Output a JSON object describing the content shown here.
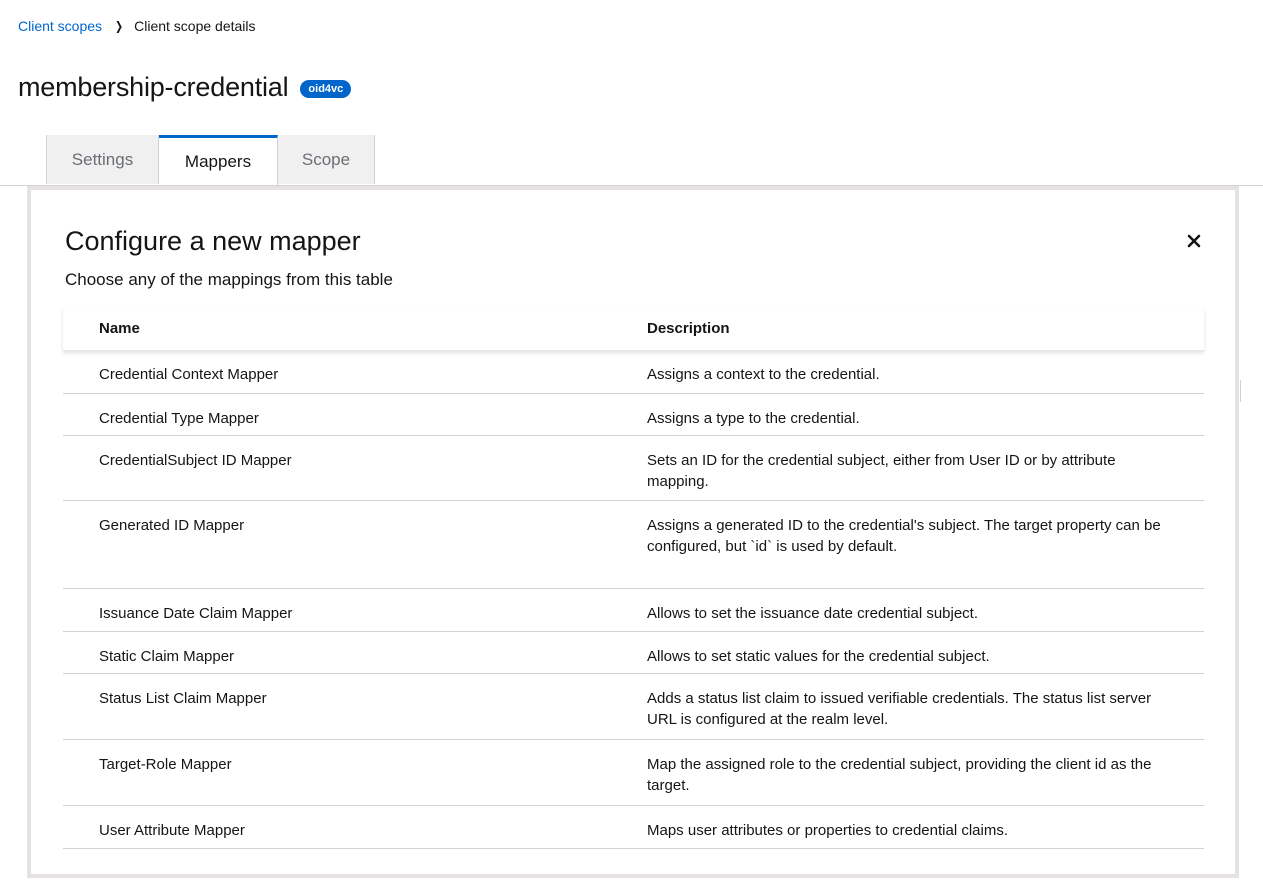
{
  "breadcrumb": {
    "parent": "Client scopes",
    "current": "Client scope details"
  },
  "header": {
    "title": "membership-credential",
    "badge": "oid4vc"
  },
  "tabs": [
    {
      "label": "Settings"
    },
    {
      "label": "Mappers"
    },
    {
      "label": "Scope"
    }
  ],
  "modal": {
    "title": "Configure a new mapper",
    "description": "Choose any of the mappings from this table",
    "close_icon": "close-icon",
    "columns": {
      "name": "Name",
      "description": "Description"
    },
    "rows": [
      {
        "name": "Credential Context Mapper",
        "description": "Assigns a context to the credential."
      },
      {
        "name": "Credential Type Mapper",
        "description": "Assigns a type to the credential."
      },
      {
        "name": "CredentialSubject ID Mapper",
        "description": "Sets an ID for the credential subject, either from User ID or by attribute mapping."
      },
      {
        "name": "Generated ID Mapper",
        "description": "Assigns a generated ID to the credential's subject. The target property can be configured, but `id` is used by default."
      },
      {
        "name": "Issuance Date Claim Mapper",
        "description": "Allows to set the issuance date credential subject."
      },
      {
        "name": "Static Claim Mapper",
        "description": "Allows to set static values for the credential subject."
      },
      {
        "name": "Status List Claim Mapper",
        "description": "Adds a status list claim to issued verifiable credentials. The status list server URL is configured at the realm level."
      },
      {
        "name": "Target-Role Mapper",
        "description": "Map the assigned role to the credential subject, providing the client id as the target."
      },
      {
        "name": "User Attribute Mapper",
        "description": "Maps user attributes or properties to credential claims."
      }
    ]
  },
  "colors": {
    "link": "#0066cc",
    "active_tab_border": "#0066cc",
    "badge_bg": "#0066cc"
  }
}
